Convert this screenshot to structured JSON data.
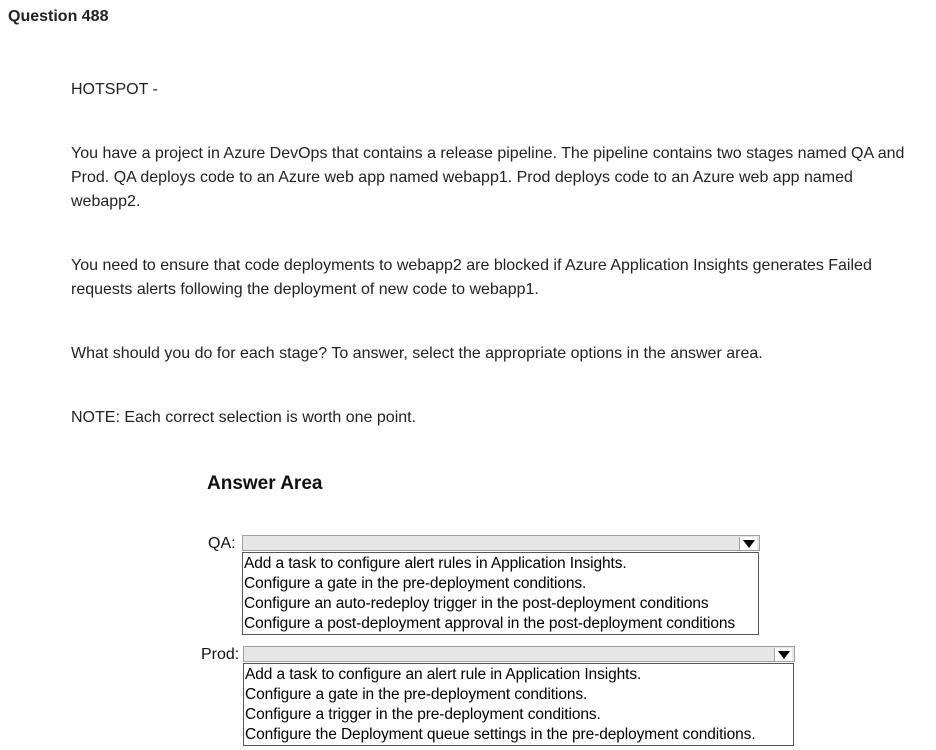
{
  "question": {
    "title": "Question 488",
    "type": "HOTSPOT -",
    "scenario": "You have a project in Azure DevOps that contains a release pipeline. The pipeline contains two stages named QA and Prod. QA deploys code to an Azure web app named webapp1. Prod deploys code to an Azure web app named webapp2.",
    "requirement": "You need to ensure that code deployments to webapp2 are blocked if Azure Application Insights generates Failed requests alerts following the deployment of new code to webapp1.",
    "instruction": "What should you do for each stage? To answer, select the appropriate options in the answer area.",
    "note": "NOTE: Each correct selection is worth one point."
  },
  "answer_area": {
    "title": "Answer Area",
    "qa": {
      "label": "QA:",
      "options": [
        "Add a task to configure alert rules in Application Insights.",
        "Configure a gate in the pre-deployment conditions.",
        "Configure an auto-redeploy trigger in the post-deployment conditions",
        "Configure a post-deployment approval in the post-deployment conditions"
      ]
    },
    "prod": {
      "label": "Prod:",
      "options": [
        "Add a task to configure an alert rule in Application Insights.",
        "Configure a gate in the pre-deployment conditions.",
        "Configure a trigger in the pre-deployment conditions.",
        "Configure the Deployment queue settings in the pre-deployment conditions."
      ]
    }
  }
}
